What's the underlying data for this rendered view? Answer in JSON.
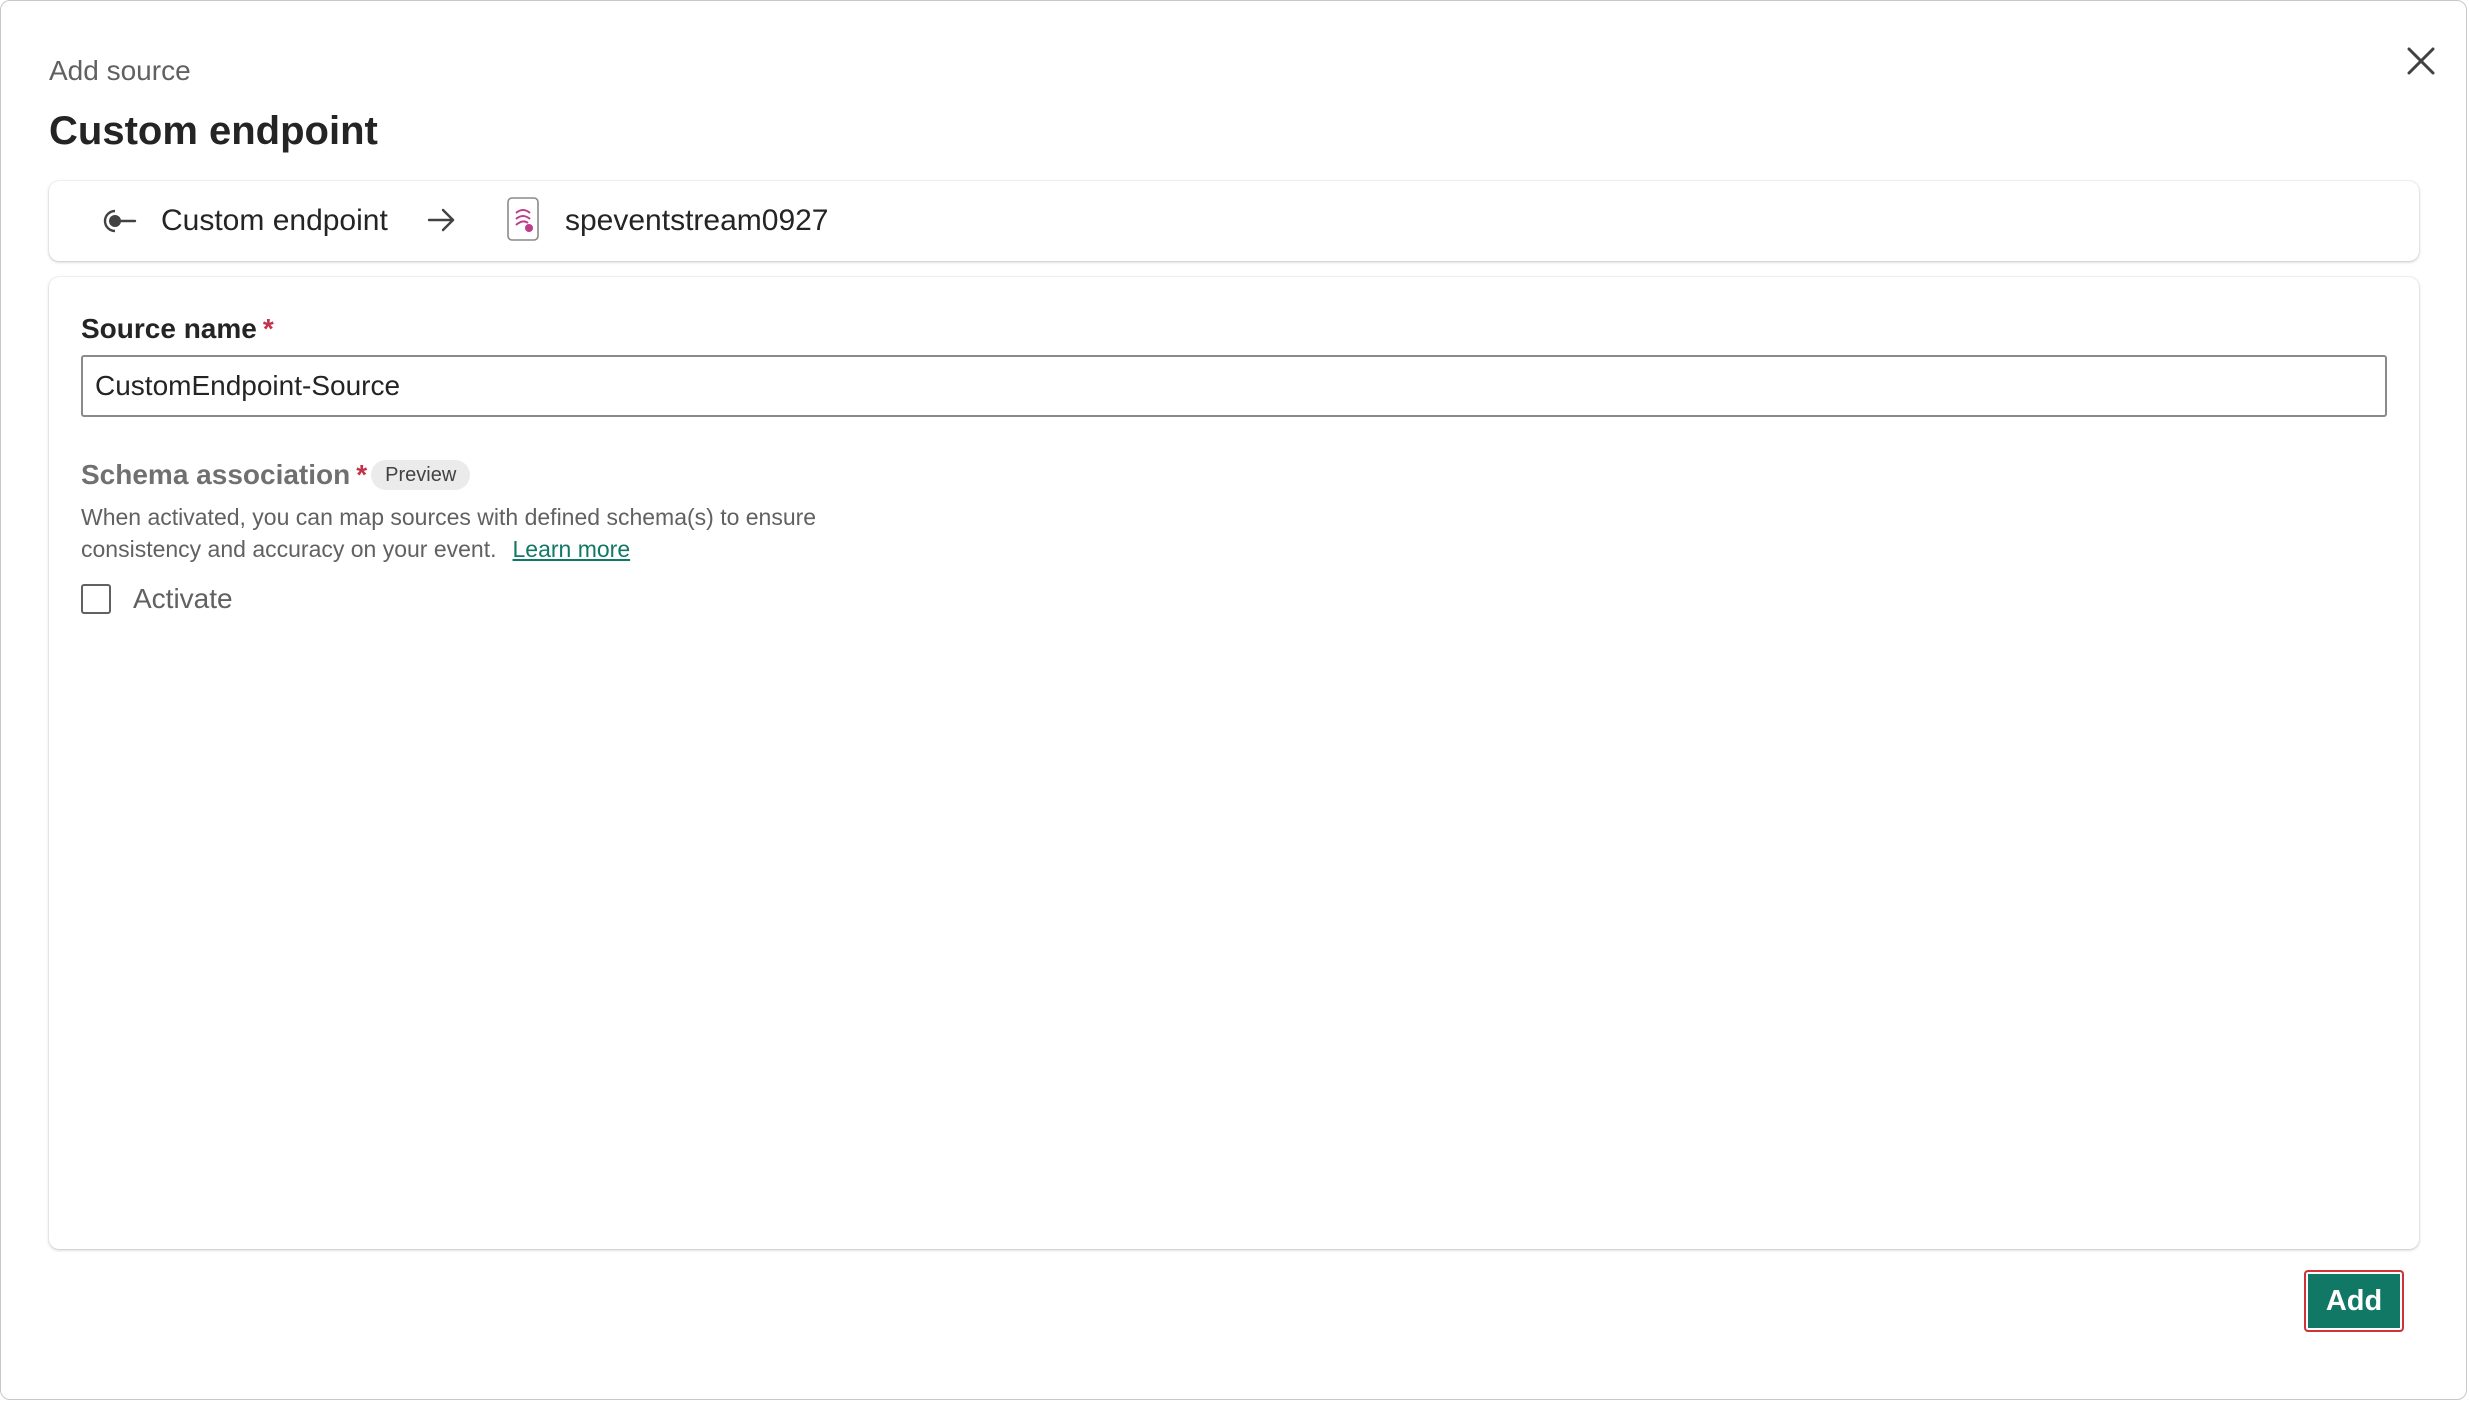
{
  "dialog": {
    "subtitle": "Add source",
    "title": "Custom endpoint",
    "close_icon": "close-icon"
  },
  "flow": {
    "source_label": "Custom endpoint",
    "source_icon": "custom-endpoint-icon",
    "arrow_icon": "arrow-right-icon",
    "destination_label": "speventstream0927",
    "destination_icon": "eventstream-icon"
  },
  "form": {
    "source_name_label": "Source name",
    "required_mark": "*",
    "source_name_value": "CustomEndpoint-Source",
    "schema_label": "Schema association",
    "preview_badge": "Preview",
    "description_line1": "When activated, you can map sources with defined schema(s) to ensure",
    "description_line2": "consistency and accuracy on your event.",
    "learn_more": "Learn more",
    "activate_label": "Activate",
    "activate_checked": false
  },
  "footer": {
    "add_label": "Add"
  },
  "colors": {
    "accent": "#117865",
    "required": "#c4314b",
    "focus_outline": "#d13438"
  }
}
